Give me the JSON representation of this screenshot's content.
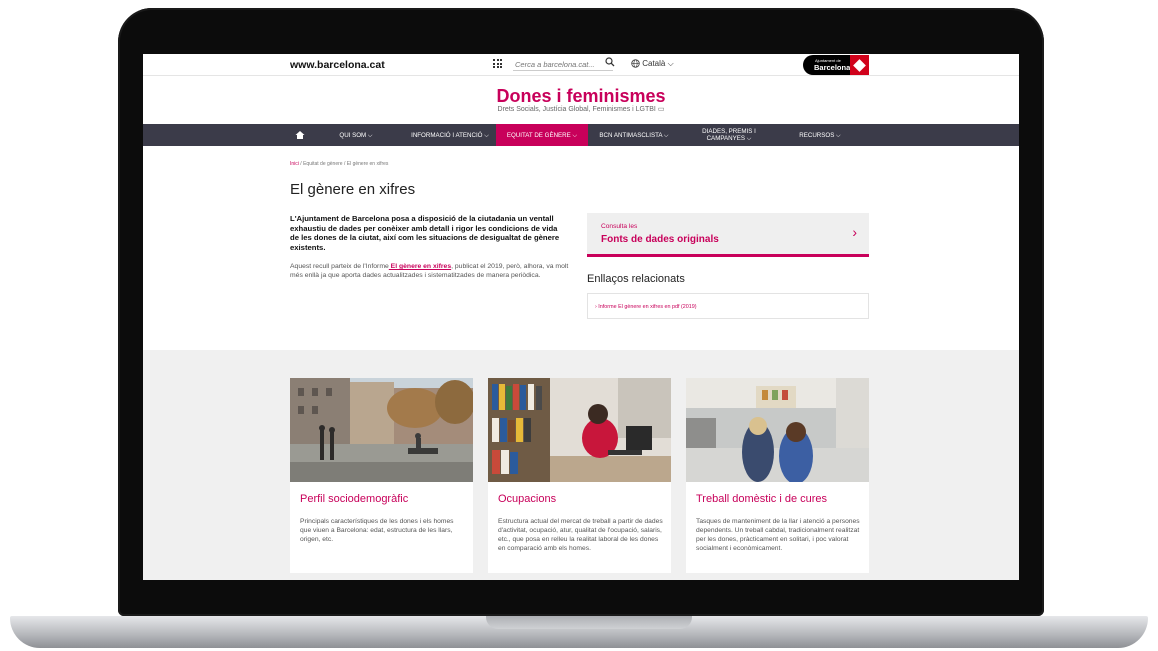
{
  "topbar": {
    "site_url": "www.barcelona.cat",
    "search_placeholder": "Cerca a barcelona.cat...",
    "language": "Català ⌵",
    "logo_small": "Ajuntament de",
    "logo_big": "Barcelona"
  },
  "header": {
    "title": "Dones i feminismes",
    "subtitle": "Drets Socials, Justícia Global, Feminismes i LGTBI ▭"
  },
  "nav": {
    "items": [
      {
        "label": "QUI SOM ⌵"
      },
      {
        "label": "INFORMACIÓ I ATENCIÓ ⌵"
      },
      {
        "label": "EQUITAT DE GÈNERE ⌵"
      },
      {
        "label": "BCN ANTIMASCLISTA ⌵"
      },
      {
        "label": "DIADES, PREMIS I CAMPANYES ⌵"
      },
      {
        "label": "RECURSOS ⌵"
      }
    ]
  },
  "breadcrumb": {
    "home": "Inici",
    "sep": " / ",
    "level1": "Equitat de gènere",
    "level2": "El gènere en xifres"
  },
  "main": {
    "title": "El gènere en xifres",
    "lead": "L'Ajuntament de Barcelona posa a disposició de la ciutadania un ventall exhaustiu de dades per conèixer amb detall i rigor les condicions de vida de les dones de la ciutat, així com les situacions de desigualtat de gènere existents.",
    "body_before": "Aquest recull parteix de l'Informe",
    "body_link": " El gènere en xifres",
    "body_after": ", publicat el 2019, però, alhora, va molt més enllà ja que aporta dades actualitzades i sistematitzades de manera periòdica."
  },
  "cta": {
    "small": "Consulta les",
    "big": "Fonts de dades originals",
    "chevron": "›"
  },
  "related": {
    "title": "Enllaços relacionats",
    "link": "› Informe El gènere en xifres en pdf (2019)"
  },
  "cards": [
    {
      "title": "Perfil sociodemogràfic",
      "desc": "Principals característiques de les dones i els homes que viuen a Barcelona: edat, estructura de les llars, origen, etc."
    },
    {
      "title": "Ocupacions",
      "desc": "Estructura actual del mercat de treball a partir de dades d'activitat, ocupació, atur, qualitat de l'ocupació, salaris, etc., que posa en relleu la realitat laboral de les dones en comparació amb els homes."
    },
    {
      "title": "Treball domèstic i de cures",
      "desc": "Tasques de manteniment de la llar i atenció a persones dependents. Un treball cabdal, tradicionalment realitzat per les dones, pràcticament en solitari, i poc valorat socialment i econòmicament."
    }
  ],
  "colors": {
    "accent": "#c8005a",
    "nav_bg": "#3b3b49",
    "section_bg": "#f0f0f0"
  }
}
